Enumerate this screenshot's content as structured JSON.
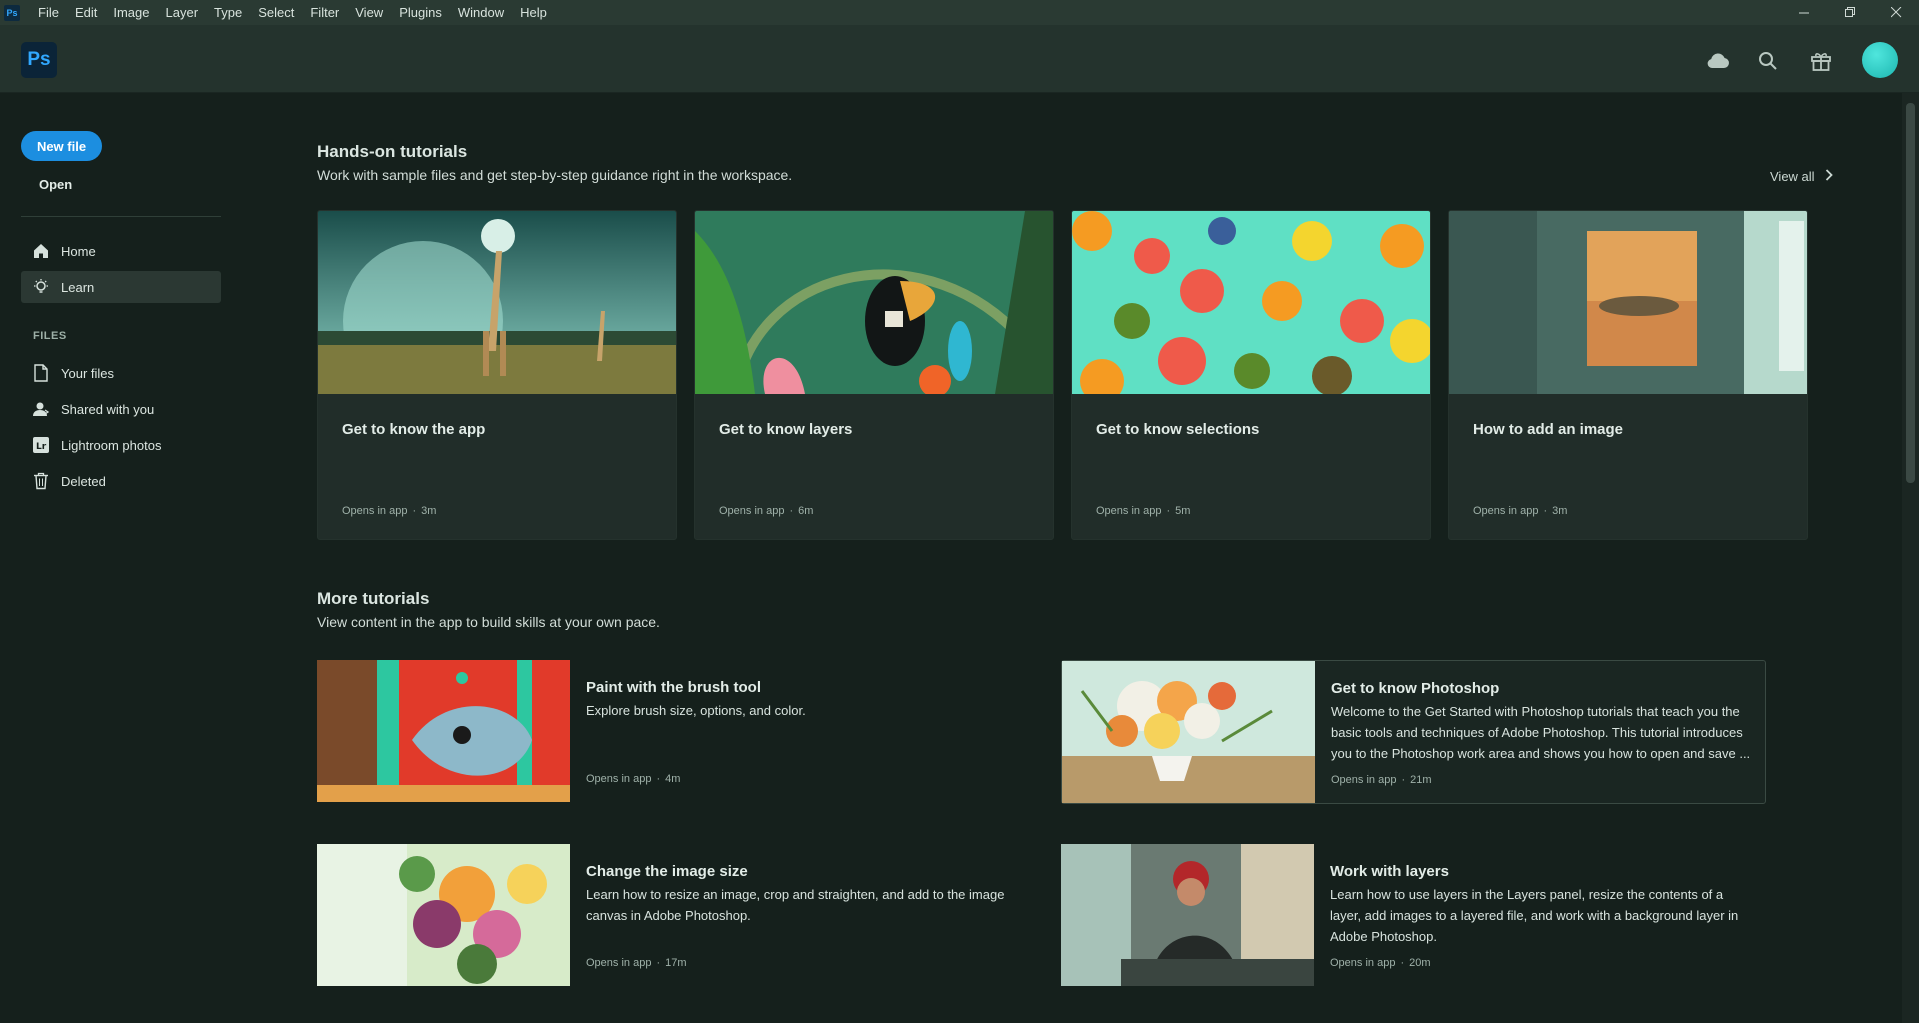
{
  "menu": {
    "app_glyph": "Ps",
    "items": [
      "File",
      "Edit",
      "Image",
      "Layer",
      "Type",
      "Select",
      "Filter",
      "View",
      "Plugins",
      "Window",
      "Help"
    ]
  },
  "header": {
    "logo_text": "Ps",
    "icons": [
      "cloud-icon",
      "search-icon",
      "gift-icon"
    ],
    "accent": "#1c8ee0"
  },
  "sidebar": {
    "new_file": "New file",
    "open": "Open",
    "nav": [
      {
        "label": "Home",
        "icon": "home-icon"
      },
      {
        "label": "Learn",
        "icon": "lightbulb-icon",
        "active": true
      }
    ],
    "files_heading": "FILES",
    "files": [
      {
        "label": "Your files",
        "icon": "file-icon"
      },
      {
        "label": "Shared with you",
        "icon": "shared-user-icon"
      },
      {
        "label": "Lightroom photos",
        "icon": "lightroom-icon"
      },
      {
        "label": "Deleted",
        "icon": "trash-icon"
      }
    ]
  },
  "hands_on": {
    "title": "Hands-on tutorials",
    "subtitle": "Work with sample files and get step-by-step guidance right in the workspace.",
    "view_all": "View all",
    "cards": [
      {
        "title": "Get to know the app",
        "meta": "Opens in app",
        "duration": "3m"
      },
      {
        "title": "Get to know layers",
        "meta": "Opens in app",
        "duration": "6m"
      },
      {
        "title": "Get to know selections",
        "meta": "Opens in app",
        "duration": "5m"
      },
      {
        "title": "How to add an image",
        "meta": "Opens in app",
        "duration": "3m"
      }
    ]
  },
  "more": {
    "title": "More tutorials",
    "subtitle": "View content in the app to build skills at your own pace.",
    "items": [
      {
        "title": "Paint with the brush tool",
        "desc": "Explore brush size, options, and color.",
        "meta": "Opens in app",
        "duration": "4m"
      },
      {
        "title": "Get to know Photoshop",
        "desc": "Welcome to the Get Started with Photoshop tutorials that teach you the basic tools and techniques of Adobe Photoshop. This tutorial introduces you to the Photoshop work area and shows you how to open and save ...",
        "meta": "Opens in app",
        "duration": "21m"
      },
      {
        "title": "Change the image size",
        "desc": "Learn how to resize an image, crop and straighten, and add to the image canvas in Adobe Photoshop.",
        "meta": "Opens in app",
        "duration": "17m"
      },
      {
        "title": "Work with layers",
        "desc": "Learn how to use layers in the Layers panel, resize the contents of a layer, add images to a layered file, and work with a background layer in Adobe Photoshop.",
        "meta": "Opens in app",
        "duration": "20m"
      }
    ]
  }
}
